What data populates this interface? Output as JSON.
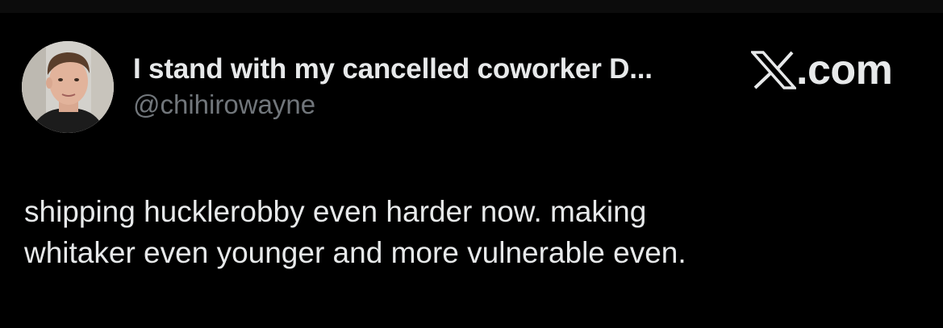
{
  "tweet": {
    "display_name": "I stand with my cancelled coworker D...",
    "handle": "@chihirowayne",
    "text_lines": [
      "shipping hucklerobby even harder now. making",
      "whitaker even younger and more vulnerable even."
    ],
    "avatar_icon": "avatar-photo"
  },
  "brand": {
    "icon": "x-logo-icon",
    "suffix": ".com"
  },
  "colors": {
    "background": "#000000",
    "primary_text": "#e7e9ea",
    "secondary_text": "#71767b"
  }
}
